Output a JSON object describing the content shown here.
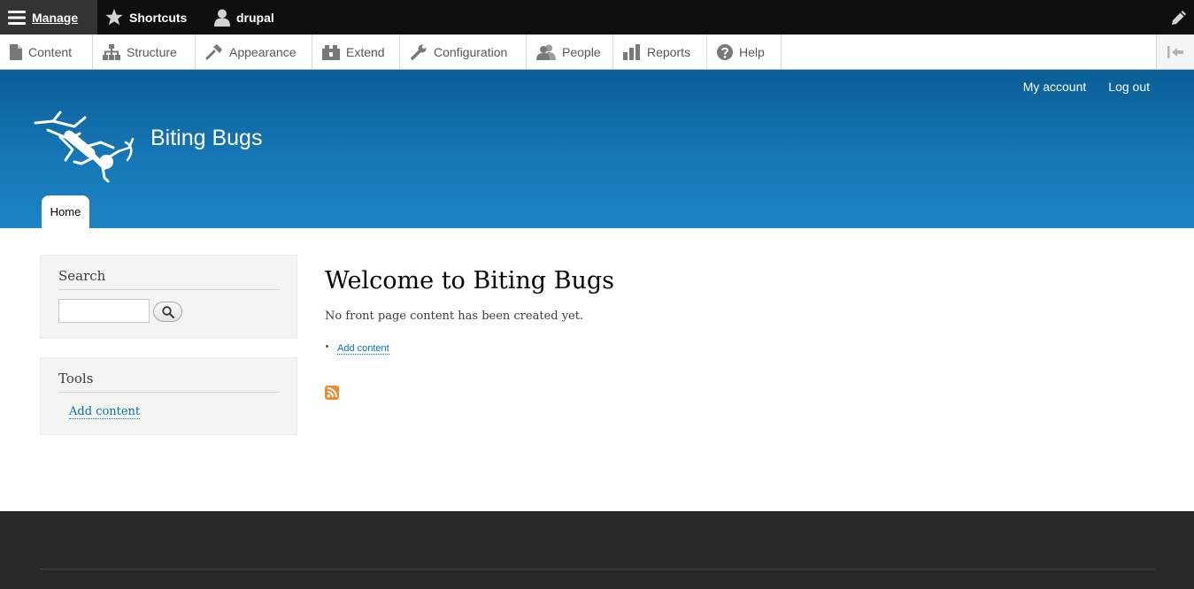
{
  "toolbar": {
    "manage": "Manage",
    "shortcuts": "Shortcuts",
    "user": "drupal"
  },
  "tray": {
    "items": [
      {
        "label": "Content",
        "icon": "content-icon"
      },
      {
        "label": "Structure",
        "icon": "structure-icon"
      },
      {
        "label": "Appearance",
        "icon": "appearance-icon"
      },
      {
        "label": "Extend",
        "icon": "extend-icon"
      },
      {
        "label": "Configuration",
        "icon": "configuration-icon"
      },
      {
        "label": "People",
        "icon": "people-icon"
      },
      {
        "label": "Reports",
        "icon": "reports-icon"
      },
      {
        "label": "Help",
        "icon": "help-icon"
      }
    ]
  },
  "header": {
    "site_name": "Biting Bugs",
    "secondary_nav": {
      "my_account": "My account",
      "log_out": "Log out"
    },
    "main_tab": "Home"
  },
  "sidebar": {
    "search": {
      "title": "Search",
      "input_value": ""
    },
    "tools": {
      "title": "Tools",
      "link": "Add content"
    }
  },
  "content": {
    "title": "Welcome to Biting Bugs",
    "message": "No front page content has been created yet.",
    "action_link": "Add content"
  },
  "colors": {
    "toolbar_bg": "#0f0f0f",
    "header_top": "#0a5d96",
    "header_bottom": "#1b85c5",
    "link": "#0071b3",
    "footer_bg": "#292929"
  }
}
